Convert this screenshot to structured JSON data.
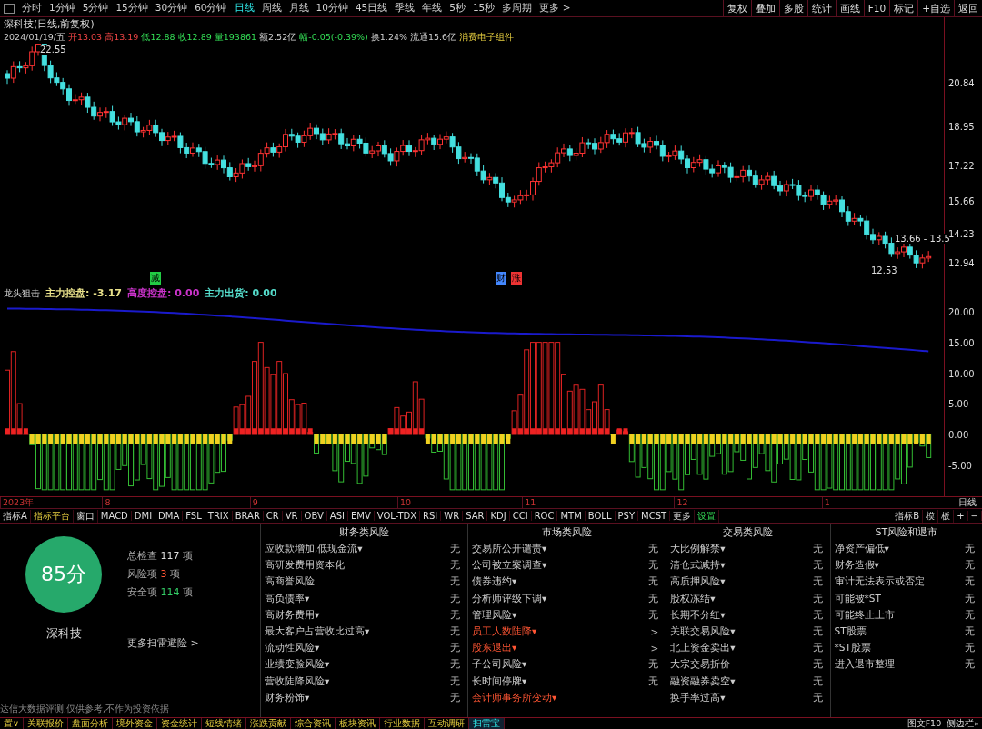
{
  "toolbar": {
    "periods": [
      {
        "label": "分时",
        "selected": false
      },
      {
        "label": "1分钟",
        "selected": false
      },
      {
        "label": "5分钟",
        "selected": false
      },
      {
        "label": "15分钟",
        "selected": false
      },
      {
        "label": "30分钟",
        "selected": false
      },
      {
        "label": "60分钟",
        "selected": false
      },
      {
        "label": "日线",
        "selected": true
      },
      {
        "label": "周线",
        "selected": false
      },
      {
        "label": "月线",
        "selected": false
      },
      {
        "label": "10分钟",
        "selected": false
      },
      {
        "label": "45日线",
        "selected": false
      },
      {
        "label": "季线",
        "selected": false
      },
      {
        "label": "年线",
        "selected": false
      },
      {
        "label": "5秒",
        "selected": false
      },
      {
        "label": "15秒",
        "selected": false
      },
      {
        "label": "多周期",
        "selected": false
      },
      {
        "label": "更多 >",
        "selected": false
      }
    ],
    "actions": [
      "复权",
      "叠加",
      "多股",
      "统计",
      "画线",
      "F10",
      "标记",
      "+自选",
      "返回"
    ]
  },
  "chart": {
    "title": "深科技(日线,前复权)",
    "quote": [
      {
        "kind": "plain",
        "text": "2024/01/19/五"
      },
      {
        "kind": "up",
        "text": "开13.03"
      },
      {
        "kind": "up",
        "text": "高13.19"
      },
      {
        "kind": "down",
        "text": "低12.88"
      },
      {
        "kind": "down",
        "text": "收12.89"
      },
      {
        "kind": "down",
        "text": "量193861"
      },
      {
        "kind": "plain",
        "text": "额2.52亿"
      },
      {
        "kind": "down",
        "text": "幅-0.05(-0.39%)"
      },
      {
        "kind": "plain",
        "text": "换1.24%"
      },
      {
        "kind": "plain",
        "text": "流通15.6亿"
      },
      {
        "kind": "tag",
        "text": "消费电子组件"
      }
    ],
    "price_labels": [
      "20.84",
      "18.95",
      "17.22",
      "15.66",
      "14.23",
      "12.94"
    ],
    "high_mark": "22.55",
    "low_mark": "12.53",
    "last_mark": "13.66 - 13.5",
    "event_marks": [
      {
        "text": "减",
        "color": "#22cc44"
      },
      {
        "text": "财",
        "color": "#4488ff"
      },
      {
        "text": "涨",
        "color": "#ee3333"
      }
    ]
  },
  "indicator": {
    "name": "龙头狙击",
    "values": [
      {
        "text": "主力控盘: -3.17",
        "color": "#e8e08a"
      },
      {
        "text": "高度控盘: 0.00",
        "color": "#cc33cc"
      },
      {
        "text": "主力出货: 0.00",
        "color": "#55ddcc"
      }
    ],
    "axis_labels": [
      "20.00",
      "15.00",
      "10.00",
      "5.00",
      "0.00",
      "-5.00"
    ]
  },
  "time_axis": {
    "labels": [
      "2023年",
      "8",
      "9",
      "10",
      "11",
      "12",
      "1"
    ],
    "period": "日线"
  },
  "indicator_tabs": {
    "left": [
      {
        "label": "指标A",
        "kind": "plain"
      },
      {
        "label": "指标平台",
        "kind": "yellow"
      },
      {
        "label": "窗口",
        "kind": "plain"
      },
      {
        "label": "MACD",
        "kind": "plain"
      },
      {
        "label": "DMI",
        "kind": "plain"
      },
      {
        "label": "DMA",
        "kind": "plain"
      },
      {
        "label": "FSL",
        "kind": "plain"
      },
      {
        "label": "TRIX",
        "kind": "plain"
      },
      {
        "label": "BRAR",
        "kind": "plain"
      },
      {
        "label": "CR",
        "kind": "plain"
      },
      {
        "label": "VR",
        "kind": "plain"
      },
      {
        "label": "OBV",
        "kind": "plain"
      },
      {
        "label": "ASI",
        "kind": "plain"
      },
      {
        "label": "EMV",
        "kind": "plain"
      },
      {
        "label": "VOL-TDX",
        "kind": "plain"
      },
      {
        "label": "RSI",
        "kind": "plain"
      },
      {
        "label": "WR",
        "kind": "plain"
      },
      {
        "label": "SAR",
        "kind": "plain"
      },
      {
        "label": "KDJ",
        "kind": "plain"
      },
      {
        "label": "CCI",
        "kind": "plain"
      },
      {
        "label": "ROC",
        "kind": "plain"
      },
      {
        "label": "MTM",
        "kind": "plain"
      },
      {
        "label": "BOLL",
        "kind": "plain"
      },
      {
        "label": "PSY",
        "kind": "plain"
      },
      {
        "label": "MCST",
        "kind": "plain"
      },
      {
        "label": "更多",
        "kind": "plain"
      },
      {
        "label": "设置",
        "kind": "green"
      }
    ],
    "right": [
      "指标B",
      "模",
      "板",
      "+",
      "−"
    ]
  },
  "risk": {
    "score": "85分",
    "stock": "深科技",
    "stats": [
      {
        "label": "总检查",
        "count": "117",
        "unit": "项",
        "kind": "total"
      },
      {
        "label": "风险项",
        "count": "3",
        "unit": "项",
        "kind": "risk"
      },
      {
        "label": "安全项",
        "count": "114",
        "unit": "项",
        "kind": "safe"
      }
    ],
    "more": "更多扫雷避险 >",
    "disclaimer": "达信大数据评测,仅供参考,不作为投资依据",
    "columns": [
      {
        "title": "财务类风险",
        "rows": [
          {
            "label": "应收款增加,低现金流▾",
            "result": "无",
            "flagged": false
          },
          {
            "label": "高研发费用资本化",
            "result": "无",
            "flagged": false
          },
          {
            "label": "高商誉风险",
            "result": "无",
            "flagged": false
          },
          {
            "label": "高负债率▾",
            "result": "无",
            "flagged": false
          },
          {
            "label": "高财务费用▾",
            "result": "无",
            "flagged": false
          },
          {
            "label": "最大客户占营收比过高▾",
            "result": "无",
            "flagged": false
          },
          {
            "label": "流动性风险▾",
            "result": "无",
            "flagged": false
          },
          {
            "label": "业绩变脸风险▾",
            "result": "无",
            "flagged": false
          },
          {
            "label": "营收陡降风险▾",
            "result": "无",
            "flagged": false
          },
          {
            "label": "财务粉饰▾",
            "result": "无",
            "flagged": false
          }
        ]
      },
      {
        "title": "市场类风险",
        "rows": [
          {
            "label": "交易所公开谴责▾",
            "result": "无",
            "flagged": false
          },
          {
            "label": "公司被立案调查▾",
            "result": "无",
            "flagged": false
          },
          {
            "label": "债券违约▾",
            "result": "无",
            "flagged": false
          },
          {
            "label": "分析师评级下调▾",
            "result": "无",
            "flagged": false
          },
          {
            "label": "管理风险▾",
            "result": "无",
            "flagged": false
          },
          {
            "label": "员工人数陡降▾",
            "result": ">",
            "flagged": true
          },
          {
            "label": "股东退出▾",
            "result": ">",
            "flagged": true
          },
          {
            "label": "子公司风险▾",
            "result": "无",
            "flagged": false
          },
          {
            "label": "长时间停牌▾",
            "result": "无",
            "flagged": false
          },
          {
            "label": "会计师事务所变动▾",
            "result": "",
            "flagged": true
          }
        ]
      },
      {
        "title": "交易类风险",
        "rows": [
          {
            "label": "大比例解禁▾",
            "result": "无",
            "flagged": false
          },
          {
            "label": "清仓式减持▾",
            "result": "无",
            "flagged": false
          },
          {
            "label": "高质押风险▾",
            "result": "无",
            "flagged": false
          },
          {
            "label": "股权冻结▾",
            "result": "无",
            "flagged": false
          },
          {
            "label": "长期不分红▾",
            "result": "无",
            "flagged": false
          },
          {
            "label": "关联交易风险▾",
            "result": "无",
            "flagged": false
          },
          {
            "label": "北上资金卖出▾",
            "result": "无",
            "flagged": false
          },
          {
            "label": "大宗交易折价",
            "result": "无",
            "flagged": false
          },
          {
            "label": "融资融券卖空▾",
            "result": "无",
            "flagged": false
          },
          {
            "label": "换手率过高▾",
            "result": "无",
            "flagged": false
          }
        ]
      },
      {
        "title": "ST风险和退市",
        "rows": [
          {
            "label": "净资产偏低▾",
            "result": "无",
            "flagged": false
          },
          {
            "label": "财务造假▾",
            "result": "无",
            "flagged": false
          },
          {
            "label": "审计无法表示或否定",
            "result": "无",
            "flagged": false
          },
          {
            "label": "可能被*ST",
            "result": "无",
            "flagged": false
          },
          {
            "label": "可能终止上市",
            "result": "无",
            "flagged": false
          },
          {
            "label": "ST股票",
            "result": "无",
            "flagged": false
          },
          {
            "label": "*ST股票",
            "result": "无",
            "flagged": false
          },
          {
            "label": "进入退市整理",
            "result": "无",
            "flagged": false
          }
        ]
      }
    ]
  },
  "bottom_tabs": [
    {
      "label": "置∨",
      "selected": false
    },
    {
      "label": "关联报价",
      "selected": false
    },
    {
      "label": "盘面分析",
      "selected": false
    },
    {
      "label": "境外资金",
      "selected": false
    },
    {
      "label": "资金统计",
      "selected": false
    },
    {
      "label": "短线情绪",
      "selected": false
    },
    {
      "label": "涨跌贡献",
      "selected": false
    },
    {
      "label": "综合资讯",
      "selected": false
    },
    {
      "label": "板块资讯",
      "selected": false
    },
    {
      "label": "行业数据",
      "selected": false
    },
    {
      "label": "互动调研",
      "selected": false
    },
    {
      "label": "扫雷宝",
      "selected": true
    }
  ],
  "bottom_right": [
    "图文F10",
    "侧边栏»"
  ]
}
